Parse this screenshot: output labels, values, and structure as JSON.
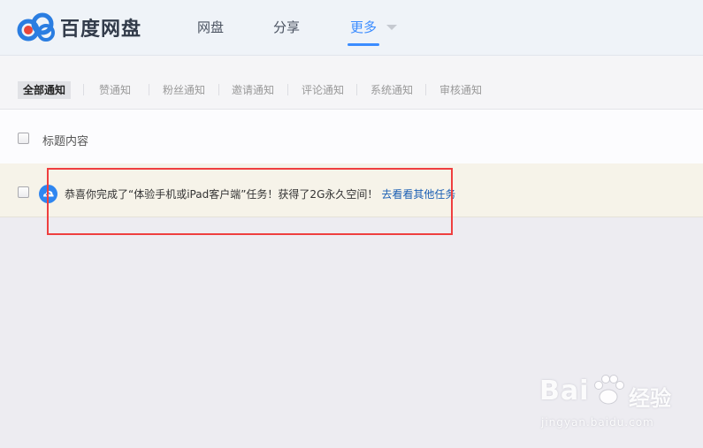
{
  "header": {
    "app_name": "百度网盘",
    "nav": [
      {
        "label": "网盘"
      },
      {
        "label": "分享"
      },
      {
        "label": "更多"
      }
    ]
  },
  "filters": [
    {
      "label": "全部通知"
    },
    {
      "label": "赞通知"
    },
    {
      "label": "粉丝通知"
    },
    {
      "label": "邀请通知"
    },
    {
      "label": "评论通知"
    },
    {
      "label": "系统通知"
    },
    {
      "label": "审核通知"
    }
  ],
  "list": {
    "header_label": "标题内容",
    "rows": [
      {
        "text": "恭喜你完成了“体验手机或iPad客户端”任务！获得了2G永久空间！",
        "link": "去看看其他任务"
      }
    ]
  },
  "watermark": {
    "brand": "Bai",
    "brand_suffix": "经验",
    "url": "jingyan.baidu.com"
  },
  "colors": {
    "accent": "#3b8cff",
    "highlight": "#ef3f3f",
    "link": "#1a5fb4"
  }
}
